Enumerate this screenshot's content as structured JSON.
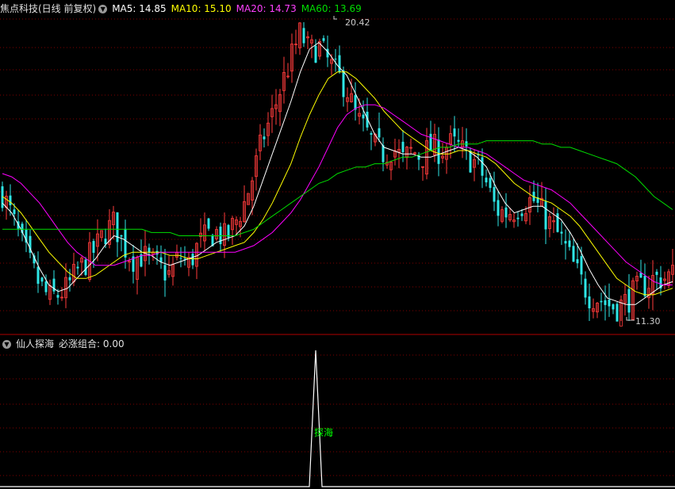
{
  "legend_main": {
    "title": "焦点科技(日线 前复权)",
    "ma5": "MA5: 14.85",
    "ma10": "MA10: 15.10",
    "ma20": "MA20: 14.73",
    "ma60": "MA60: 13.69",
    "icon": "chevron-down-icon"
  },
  "legend_sub": {
    "title": "仙人探海",
    "value": "必涨组合: 0.00",
    "icon": "chevron-down-icon"
  },
  "annotations": {
    "high": "20.42",
    "low": "11.30",
    "signal": "探海"
  },
  "colors": {
    "up": "#ff3b3b",
    "down": "#2ee6e6",
    "ma5": "#ffffff",
    "ma10": "#ffff00",
    "ma20": "#ff00ff",
    "ma60": "#00dd00",
    "signal": "#ffffff",
    "signal_label": "#00ff00",
    "grid": "#800000"
  },
  "chart_data": {
    "type": "candlestick",
    "price_high": 20.42,
    "price_low": 11.3,
    "ma_latest": {
      "MA5": 14.85,
      "MA10": 15.1,
      "MA20": 14.73,
      "MA60": 13.69
    },
    "ma_series": {
      "MA5": [
        14.9,
        14.6,
        14.1,
        13.5,
        12.9,
        12.4,
        12.2,
        12.3,
        12.6,
        12.9,
        13.2,
        13.6,
        13.9,
        13.8,
        13.6,
        13.4,
        13.3,
        13.1,
        13.0,
        13.1,
        13.2,
        13.3,
        13.5,
        13.7,
        13.8,
        13.9,
        14.2,
        14.8,
        15.6,
        16.4,
        17.2,
        18.0,
        18.9,
        19.6,
        19.8,
        19.5,
        19.1,
        18.8,
        18.2,
        17.6,
        17.0,
        16.6,
        16.5,
        16.4,
        16.4,
        16.3,
        16.3,
        16.4,
        16.5,
        16.6,
        16.5,
        16.3,
        16.0,
        15.4,
        14.9,
        14.6,
        14.7,
        14.8,
        14.8,
        14.6,
        14.4,
        14.0,
        13.5,
        12.9,
        12.4,
        12.0,
        11.9,
        11.8,
        11.8,
        12.0,
        12.2,
        12.4,
        12.5
      ],
      "MA10": [
        15.1,
        14.9,
        14.6,
        14.2,
        13.8,
        13.4,
        13.1,
        12.8,
        12.6,
        12.6,
        12.7,
        12.9,
        13.1,
        13.3,
        13.4,
        13.4,
        13.4,
        13.4,
        13.3,
        13.3,
        13.2,
        13.2,
        13.3,
        13.4,
        13.5,
        13.6,
        13.7,
        14.0,
        14.4,
        14.9,
        15.5,
        16.1,
        16.9,
        17.6,
        18.2,
        18.7,
        18.9,
        18.9,
        18.7,
        18.4,
        18.1,
        17.7,
        17.4,
        17.1,
        16.9,
        16.7,
        16.5,
        16.4,
        16.4,
        16.5,
        16.5,
        16.4,
        16.3,
        16.1,
        15.8,
        15.5,
        15.3,
        15.1,
        15.0,
        14.9,
        14.7,
        14.5,
        14.2,
        13.8,
        13.4,
        13.0,
        12.6,
        12.4,
        12.2,
        12.1,
        12.1,
        12.2,
        12.3
      ],
      "MA20": [
        15.8,
        15.7,
        15.5,
        15.2,
        14.9,
        14.5,
        14.1,
        13.7,
        13.4,
        13.2,
        13.0,
        13.0,
        13.0,
        13.1,
        13.2,
        13.3,
        13.3,
        13.4,
        13.4,
        13.4,
        13.4,
        13.4,
        13.4,
        13.4,
        13.4,
        13.4,
        13.5,
        13.6,
        13.8,
        14.0,
        14.3,
        14.6,
        15.0,
        15.5,
        16.0,
        16.6,
        17.2,
        17.6,
        17.8,
        17.9,
        17.9,
        17.8,
        17.6,
        17.4,
        17.2,
        17.0,
        16.9,
        16.8,
        16.7,
        16.6,
        16.6,
        16.5,
        16.4,
        16.2,
        16.0,
        15.8,
        15.6,
        15.5,
        15.4,
        15.3,
        15.1,
        14.9,
        14.6,
        14.3,
        14.0,
        13.7,
        13.4,
        13.1,
        12.9,
        12.7,
        12.5,
        12.4,
        12.4
      ],
      "MA60": [
        14.1,
        14.1,
        14.1,
        14.1,
        14.1,
        14.1,
        14.1,
        14.1,
        14.1,
        14.1,
        14.1,
        14.1,
        14.1,
        14.1,
        14.1,
        14.1,
        14.0,
        14.0,
        14.0,
        13.9,
        13.9,
        13.9,
        13.9,
        13.9,
        13.9,
        13.9,
        14.0,
        14.1,
        14.3,
        14.5,
        14.7,
        14.9,
        15.1,
        15.3,
        15.5,
        15.6,
        15.8,
        15.9,
        16.0,
        16.0,
        16.1,
        16.1,
        16.2,
        16.3,
        16.3,
        16.4,
        16.5,
        16.6,
        16.6,
        16.7,
        16.7,
        16.7,
        16.8,
        16.8,
        16.8,
        16.8,
        16.8,
        16.8,
        16.7,
        16.7,
        16.6,
        16.6,
        16.5,
        16.4,
        16.3,
        16.2,
        16.1,
        15.9,
        15.7,
        15.4,
        15.1,
        14.9,
        14.7
      ]
    },
    "closes": [
      15.2,
      14.5,
      13.7,
      13.0,
      12.4,
      12.0,
      12.1,
      12.3,
      12.8,
      13.1,
      13.5,
      14.0,
      14.3,
      13.6,
      13.2,
      13.3,
      13.1,
      12.9,
      12.7,
      13.3,
      13.0,
      13.6,
      13.9,
      14.0,
      13.8,
      14.3,
      14.9,
      15.8,
      16.9,
      17.6,
      18.5,
      19.3,
      20.1,
      19.5,
      19.7,
      19.2,
      18.8,
      18.4,
      17.5,
      17.1,
      16.6,
      16.4,
      16.6,
      16.2,
      16.5,
      16.3,
      16.6,
      16.5,
      16.7,
      16.6,
      16.3,
      16.1,
      15.5,
      14.7,
      14.6,
      14.7,
      14.9,
      15.0,
      14.6,
      14.2,
      13.8,
      13.2,
      12.6,
      12.1,
      12.0,
      11.8,
      11.7,
      11.9,
      12.2,
      12.4,
      12.6,
      12.6,
      12.7
    ],
    "indicator": {
      "name": "仙人探海",
      "series": "必涨组合",
      "latest": 0.0,
      "signal_bar_index": 398,
      "signal_value": 1,
      "ylim": [
        0,
        1
      ]
    }
  }
}
